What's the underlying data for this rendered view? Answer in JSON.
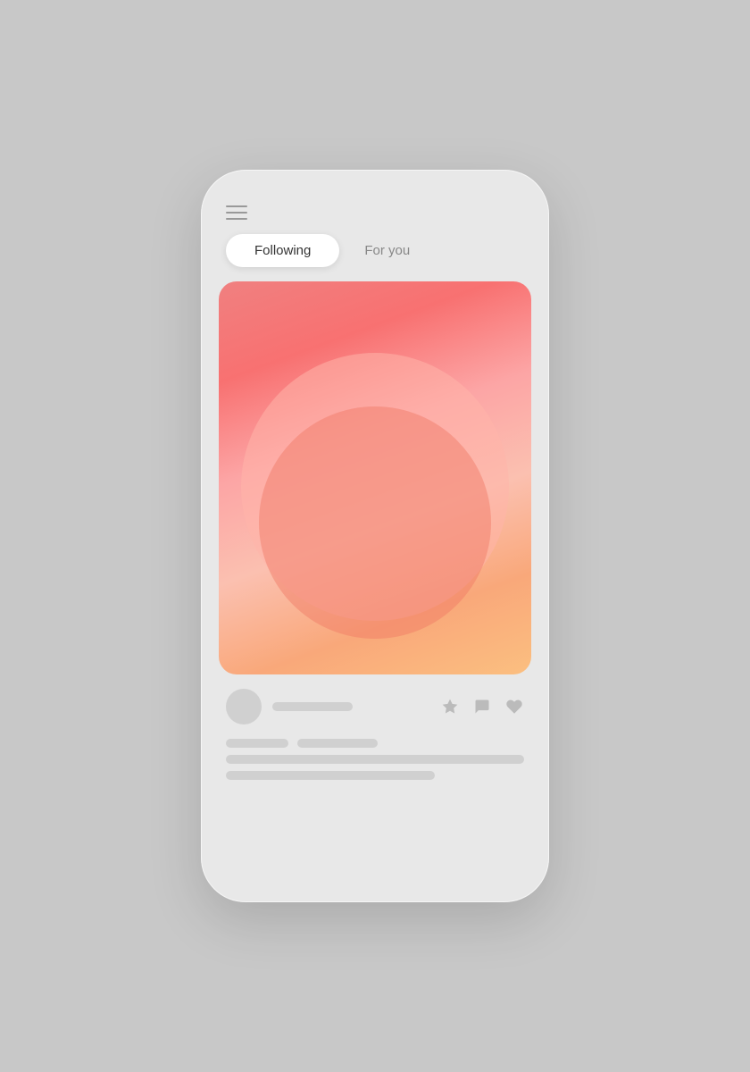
{
  "background_color": "#c8c8c8",
  "phone": {
    "header": {
      "menu_icon": "hamburger-icon"
    },
    "tabs": [
      {
        "id": "following",
        "label": "Following",
        "active": true
      },
      {
        "id": "foryou",
        "label": "For you",
        "active": false
      }
    ],
    "post": {
      "image_alt": "Abstract gradient art with pink and salmon circles",
      "author_placeholder": "",
      "actions": [
        {
          "id": "bookmark",
          "icon": "star-icon"
        },
        {
          "id": "comment",
          "icon": "comment-icon"
        },
        {
          "id": "like",
          "icon": "heart-icon"
        }
      ],
      "content_lines": 3
    }
  }
}
